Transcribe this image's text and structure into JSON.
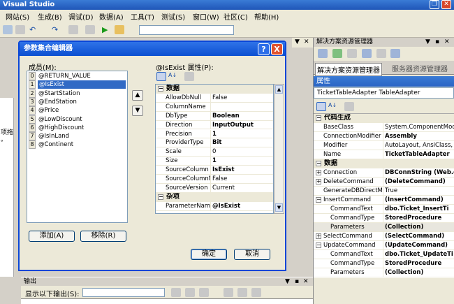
{
  "window": {
    "title": "Visual Studio"
  },
  "menu": [
    "网站(S)",
    "生成(B)",
    "调试(D)",
    "数据(A)",
    "工具(T)",
    "测试(S)",
    "窗口(W)",
    "社区(C)",
    "帮助(H)"
  ],
  "left_text": [
    "项拖",
    "。"
  ],
  "dialog": {
    "title": "参数集合编辑器",
    "members_label": "成员(M):",
    "members": [
      {
        "index": "0",
        "name": "@RETURN_VALUE"
      },
      {
        "index": "1",
        "name": "@IsExist"
      },
      {
        "index": "2",
        "name": "@StartStation"
      },
      {
        "index": "3",
        "name": "@EndStation"
      },
      {
        "index": "4",
        "name": "@Price"
      },
      {
        "index": "5",
        "name": "@LowDiscount"
      },
      {
        "index": "6",
        "name": "@HighDiscount"
      },
      {
        "index": "7",
        "name": "@IsInLand"
      },
      {
        "index": "8",
        "name": "@Continent"
      }
    ],
    "selected_member": "@IsExist",
    "props_label": "@IsExist 属性(P):",
    "grid": [
      {
        "type": "category",
        "name": "数据"
      },
      {
        "name": "AllowDbNull",
        "value": "False"
      },
      {
        "name": "ColumnName",
        "value": ""
      },
      {
        "name": "DbType",
        "value": "Boolean",
        "bold": true
      },
      {
        "name": "Direction",
        "value": "InputOutput",
        "bold": true
      },
      {
        "name": "Precision",
        "value": "1",
        "bold": true
      },
      {
        "name": "ProviderType",
        "value": "Bit",
        "bold": true
      },
      {
        "name": "Scale",
        "value": "0"
      },
      {
        "name": "Size",
        "value": "1",
        "bold": true
      },
      {
        "name": "SourceColumn",
        "value": "IsExist",
        "bold": true
      },
      {
        "name": "SourceColumnNu",
        "value": "False"
      },
      {
        "name": "SourceVersion",
        "value": "Current"
      },
      {
        "type": "category",
        "name": "杂项"
      },
      {
        "name": "ParameterName",
        "value": "@IsExist",
        "bold": true
      }
    ],
    "add_label": "添加(A)",
    "remove_label": "移除(R)",
    "ok_label": "确定",
    "cancel_label": "取消",
    "help_glyph": "?",
    "close_glyph": "X",
    "up_glyph": "▲",
    "down_glyph": "▼"
  },
  "output": {
    "title": "输出",
    "show_label": "显示以下输出(S):"
  },
  "solution": {
    "title": "解决方案资源管理器",
    "tab1": "解决方案资源管理器",
    "tab2": "服务器资源管理器"
  },
  "properties": {
    "title": "属性",
    "object": "TicketTableAdapter TableAdapter",
    "rows": [
      {
        "type": "category",
        "name": "代码生成"
      },
      {
        "name": "BaseClass",
        "value": "System.ComponentModel."
      },
      {
        "name": "ConnectionModifier",
        "value": "Assembly",
        "bold": true
      },
      {
        "name": "Modifier",
        "value": "AutoLayout, AnsiClass,"
      },
      {
        "name": "Name",
        "value": "TicketTableAdapter",
        "bold": true
      },
      {
        "type": "category",
        "name": "数据"
      },
      {
        "name": "Connection",
        "value": "DBConnString (Web.c",
        "bold": true,
        "expander": "+"
      },
      {
        "name": "DeleteCommand",
        "value": "(DeleteCommand)",
        "bold": true,
        "expander": "+"
      },
      {
        "name": "GenerateDBDirectMe",
        "value": "True"
      },
      {
        "name": "InsertCommand",
        "value": "(InsertCommand)",
        "bold": true,
        "expander": "−"
      },
      {
        "name": "CommandText",
        "value": "dbo.Ticket_InsertTi",
        "bold": true,
        "indent": true
      },
      {
        "name": "CommandType",
        "value": "StoredProcedure",
        "bold": true,
        "indent": true
      },
      {
        "name": "Parameters",
        "value": "(Collection)",
        "bold": true,
        "indent": true,
        "highlight": true
      },
      {
        "name": "SelectCommand",
        "value": "(SelectCommand)",
        "bold": true,
        "expander": "+"
      },
      {
        "name": "UpdateCommand",
        "value": "(UpdateCommand)",
        "bold": true,
        "expander": "−"
      },
      {
        "name": "CommandText",
        "value": "dbo.Ticket_UpdateTi",
        "bold": true,
        "indent": true
      },
      {
        "name": "CommandType",
        "value": "StoredProcedure",
        "bold": true,
        "indent": true
      },
      {
        "name": "Parameters",
        "value": "(Collection)",
        "bold": true,
        "indent": true
      }
    ]
  }
}
